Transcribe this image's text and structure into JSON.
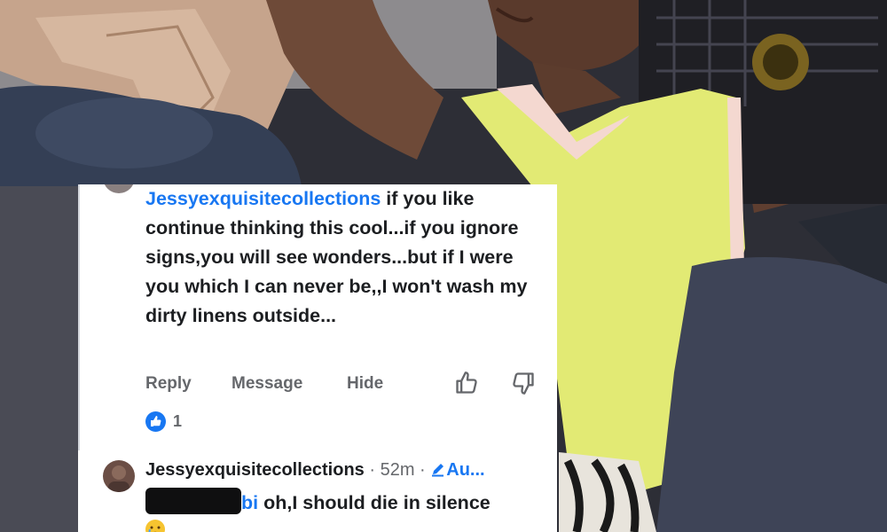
{
  "comment1": {
    "author": "Jessyexquisitecollections",
    "text": " if you like continue thinking this cool...if you ignore signs,you will see wonders...but if I were you which I can never be,,I won't wash my dirty linens outside...",
    "actions": {
      "reply": "Reply",
      "message": "Message",
      "hide": "Hide"
    },
    "reaction_count": "1"
  },
  "comment2": {
    "author": "Jessyexquisitecollections",
    "time": " · 52m · ",
    "author_badge": "Au...",
    "tag_suffix": "bi",
    "text": " oh,I should die in silence"
  },
  "colors": {
    "link": "#1877f2",
    "meta": "#65676b",
    "text": "#1c1e21"
  },
  "icons": [
    "thumbs-up-icon",
    "thumbs-down-icon",
    "like-reaction-icon",
    "pencil-icon",
    "crying-emoji-icon"
  ]
}
